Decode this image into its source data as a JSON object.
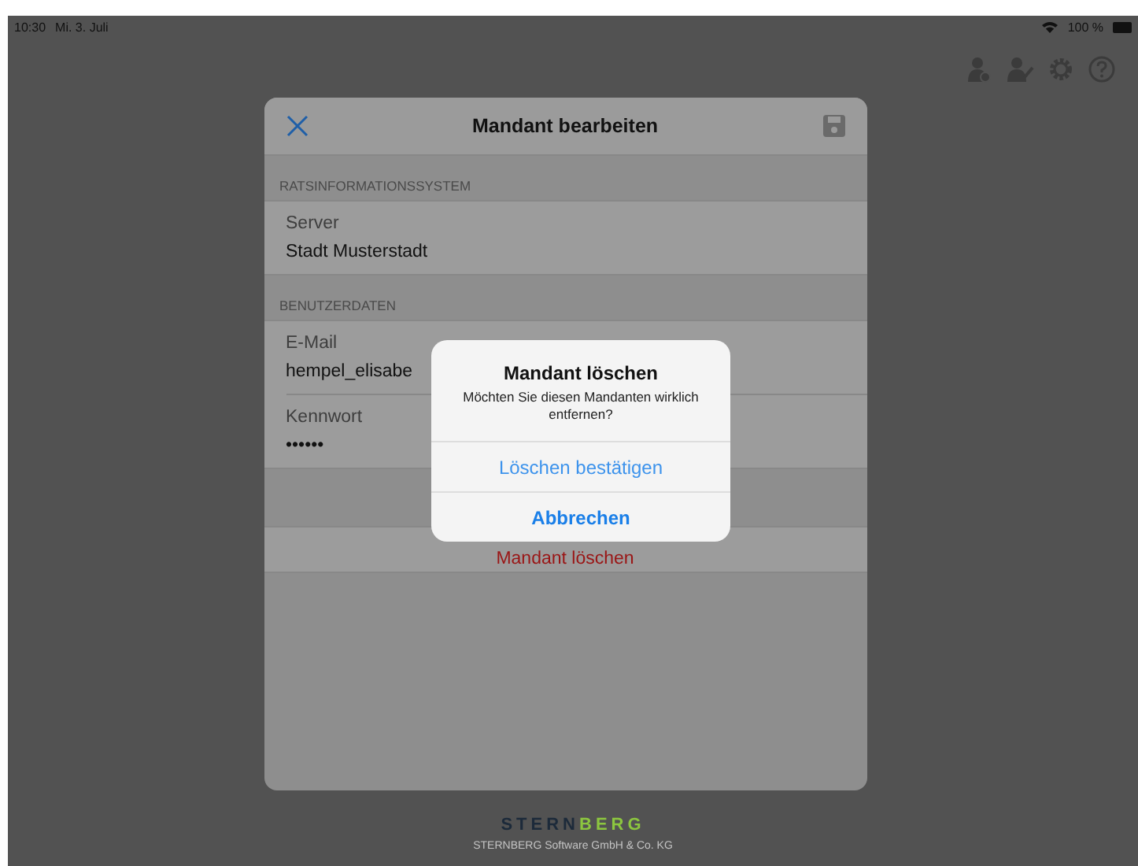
{
  "status_bar": {
    "time": "10:30",
    "date": "Mi. 3. Juli",
    "battery": "100 %"
  },
  "dialog": {
    "title": "Mandant bearbeiten",
    "sections": [
      {
        "header": "RATSINFORMATIONSSYSTEM",
        "fields": [
          {
            "label": "Server",
            "value": "Stadt Musterstadt"
          }
        ]
      },
      {
        "header": "BENUTZERDATEN",
        "fields": [
          {
            "label": "E-Mail",
            "value": "hempel_elisabe"
          },
          {
            "label": "Kennwort",
            "value": "••••••"
          }
        ]
      }
    ],
    "delete_button": "Mandant löschen"
  },
  "alert": {
    "title": "Mandant löschen",
    "message": "Möchten Sie diesen Mandanten wirklich entfernen?",
    "actions": [
      {
        "label": "Löschen bestätigen",
        "kind": "default"
      },
      {
        "label": "Abbrechen",
        "kind": "cancel"
      }
    ]
  },
  "footer": {
    "logo_first": "STERN",
    "logo_second": "BERG",
    "company": "STERNBERG Software GmbH & Co. KG"
  }
}
